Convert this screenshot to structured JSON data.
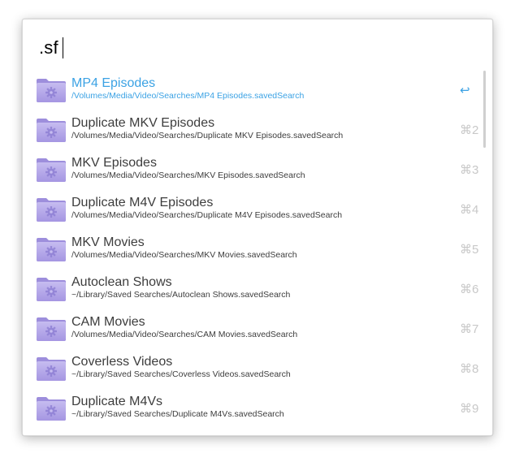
{
  "search": {
    "query": ".sf"
  },
  "colors": {
    "selected": "#3ba2e4",
    "text": "#3d3d3d",
    "shortcut": "#c8c8c8",
    "folder": "#b4a7e8"
  },
  "results": [
    {
      "title": "MP4 Episodes",
      "path": "/Volumes/Media/Video/Searches/MP4 Episodes.savedSearch",
      "shortcut": "↩",
      "icon": "smart-folder-icon"
    },
    {
      "title": "Duplicate MKV Episodes",
      "path": "/Volumes/Media/Video/Searches/Duplicate MKV Episodes.savedSearch",
      "shortcut": "⌘2",
      "icon": "smart-folder-icon"
    },
    {
      "title": "MKV Episodes",
      "path": "/Volumes/Media/Video/Searches/MKV Episodes.savedSearch",
      "shortcut": "⌘3",
      "icon": "smart-folder-icon"
    },
    {
      "title": "Duplicate M4V Episodes",
      "path": "/Volumes/Media/Video/Searches/Duplicate M4V Episodes.savedSearch",
      "shortcut": "⌘4",
      "icon": "smart-folder-icon"
    },
    {
      "title": "MKV Movies",
      "path": "/Volumes/Media/Video/Searches/MKV Movies.savedSearch",
      "shortcut": "⌘5",
      "icon": "smart-folder-icon"
    },
    {
      "title": "Autoclean Shows",
      "path": "~/Library/Saved Searches/Autoclean Shows.savedSearch",
      "shortcut": "⌘6",
      "icon": "smart-folder-icon"
    },
    {
      "title": "CAM Movies",
      "path": "/Volumes/Media/Video/Searches/CAM Movies.savedSearch",
      "shortcut": "⌘7",
      "icon": "smart-folder-icon"
    },
    {
      "title": "Coverless Videos",
      "path": "~/Library/Saved Searches/Coverless Videos.savedSearch",
      "shortcut": "⌘8",
      "icon": "smart-folder-icon"
    },
    {
      "title": "Duplicate M4Vs",
      "path": "~/Library/Saved Searches/Duplicate M4Vs.savedSearch",
      "shortcut": "⌘9",
      "icon": "smart-folder-icon"
    }
  ]
}
